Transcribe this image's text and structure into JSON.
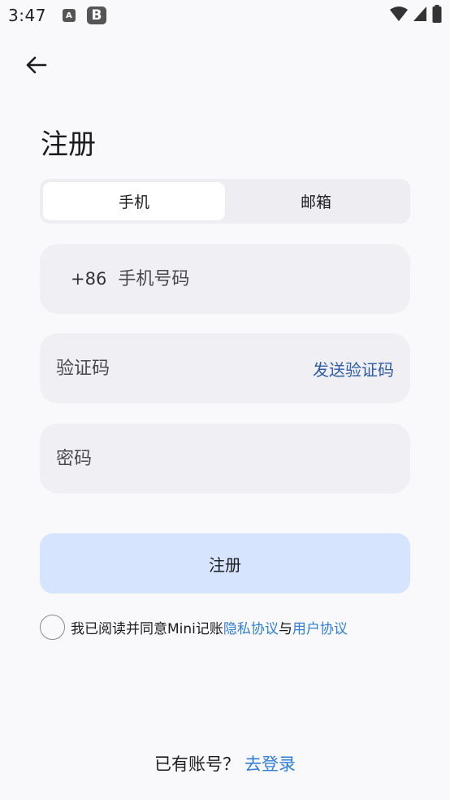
{
  "status_bar": {
    "time": "3:47",
    "icon_a": "A",
    "icon_b": "B",
    "icons": [
      "wifi-icon",
      "cellular-signal-icon",
      "battery-icon"
    ]
  },
  "header": {
    "back_icon": "back-arrow-icon",
    "title": "注册"
  },
  "tabs": [
    {
      "label": "手机",
      "active": true
    },
    {
      "label": "邮箱",
      "active": false
    }
  ],
  "form": {
    "phone_prefix": "+86",
    "phone_placeholder": "手机号码",
    "code_placeholder": "验证码",
    "send_code_label": "发送验证码",
    "password_placeholder": "密码"
  },
  "register_label": "注册",
  "agreement": {
    "checked": false,
    "prefix": "我已阅读并同意Mini记账",
    "privacy_link": "隐私协议",
    "conjunction": "与",
    "user_link": "用户协议"
  },
  "footer": {
    "question": "已有账号？",
    "login_link": "去登录"
  },
  "colors": {
    "accent": "#2f7fd6",
    "send_code": "#2f5da3",
    "button_bg": "#d6e4fd",
    "field_bg": "#f0f0f4",
    "page_bg": "#f9f9fb"
  }
}
